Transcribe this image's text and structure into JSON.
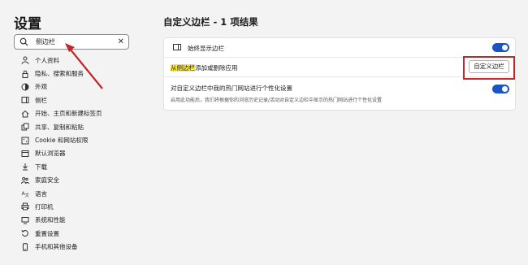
{
  "sidebar": {
    "title": "设置",
    "search": {
      "value": "侧边栏"
    },
    "items": [
      {
        "label": "个人资料",
        "icon": "person-icon"
      },
      {
        "label": "隐私、搜索和服务",
        "icon": "lock-icon"
      },
      {
        "label": "外观",
        "icon": "appearance-icon"
      },
      {
        "label": "侧栏",
        "icon": "sidebar-icon"
      },
      {
        "label": "开始、主页和新建标签页",
        "icon": "home-icon"
      },
      {
        "label": "共享、复制和粘贴",
        "icon": "share-icon"
      },
      {
        "label": "Cookie 和网站权限",
        "icon": "cookie-icon"
      },
      {
        "label": "默认浏览器",
        "icon": "browser-icon"
      },
      {
        "label": "下载",
        "icon": "download-icon"
      },
      {
        "label": "家庭安全",
        "icon": "family-icon"
      },
      {
        "label": "语言",
        "icon": "language-icon"
      },
      {
        "label": "打印机",
        "icon": "printer-icon"
      },
      {
        "label": "系统和性能",
        "icon": "system-icon"
      },
      {
        "label": "重置设置",
        "icon": "reset-icon"
      },
      {
        "label": "手机和其他设备",
        "icon": "phone-icon"
      }
    ]
  },
  "main": {
    "title": "自定义边栏 - 1 项结果",
    "rows": {
      "always_show": {
        "label": "始终显示边栏",
        "toggle": true
      },
      "add_remove": {
        "label_hl": "从侧边栏",
        "label_rest": "添加或删除应用",
        "button": "自定义边栏"
      },
      "personalize": {
        "label": "对自定义边栏中我的热门网站进行个性化设置",
        "desc": "启用此功能后，我们将根据你的浏览历史记录/活动对自定义边栏中显示的热门网站进行个性化设置",
        "toggle": true
      }
    }
  },
  "colors": {
    "accent": "#1a55c7",
    "highlight": "#ffeb3b",
    "annotation": "#c0282c"
  }
}
